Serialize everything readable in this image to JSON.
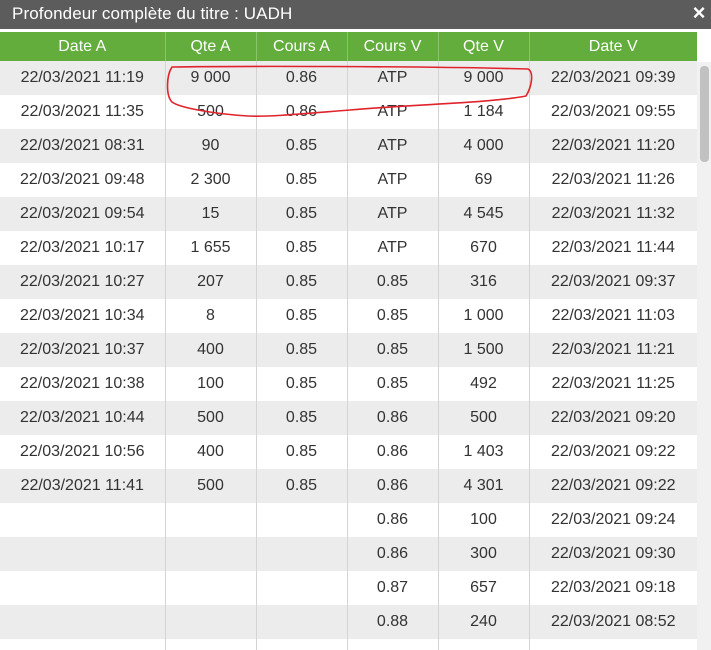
{
  "window": {
    "title": "Profondeur complète du titre : UADH",
    "close_icon": "×"
  },
  "table": {
    "columns": [
      "Date A",
      "Qte A",
      "Cours A",
      "Cours V",
      "Qte V",
      "Date V"
    ],
    "rows": [
      [
        "22/03/2021 11:19",
        "9 000",
        "0.86",
        "ATP",
        "9 000",
        "22/03/2021 09:39"
      ],
      [
        "22/03/2021 11:35",
        "500",
        "0.86",
        "ATP",
        "1 184",
        "22/03/2021 09:55"
      ],
      [
        "22/03/2021 08:31",
        "90",
        "0.85",
        "ATP",
        "4 000",
        "22/03/2021 11:20"
      ],
      [
        "22/03/2021 09:48",
        "2 300",
        "0.85",
        "ATP",
        "69",
        "22/03/2021 11:26"
      ],
      [
        "22/03/2021 09:54",
        "15",
        "0.85",
        "ATP",
        "4 545",
        "22/03/2021 11:32"
      ],
      [
        "22/03/2021 10:17",
        "1 655",
        "0.85",
        "ATP",
        "670",
        "22/03/2021 11:44"
      ],
      [
        "22/03/2021 10:27",
        "207",
        "0.85",
        "0.85",
        "316",
        "22/03/2021 09:37"
      ],
      [
        "22/03/2021 10:34",
        "8",
        "0.85",
        "0.85",
        "1 000",
        "22/03/2021 11:03"
      ],
      [
        "22/03/2021 10:37",
        "400",
        "0.85",
        "0.85",
        "1 500",
        "22/03/2021 11:21"
      ],
      [
        "22/03/2021 10:38",
        "100",
        "0.85",
        "0.85",
        "492",
        "22/03/2021 11:25"
      ],
      [
        "22/03/2021 10:44",
        "500",
        "0.85",
        "0.86",
        "500",
        "22/03/2021 09:20"
      ],
      [
        "22/03/2021 10:56",
        "400",
        "0.85",
        "0.86",
        "1 403",
        "22/03/2021 09:22"
      ],
      [
        "22/03/2021 11:41",
        "500",
        "0.85",
        "0.86",
        "4 301",
        "22/03/2021 09:22"
      ],
      [
        "",
        "",
        "",
        "0.86",
        "100",
        "22/03/2021 09:24"
      ],
      [
        "",
        "",
        "",
        "0.86",
        "300",
        "22/03/2021 09:30"
      ],
      [
        "",
        "",
        "",
        "0.87",
        "657",
        "22/03/2021 09:18"
      ],
      [
        "",
        "",
        "",
        "0.88",
        "240",
        "22/03/2021 08:52"
      ],
      [
        "",
        "",
        "",
        "",
        "",
        ""
      ]
    ]
  },
  "colors": {
    "header_bg": "#62ad3c",
    "titlebar_bg": "#5c5c5c",
    "row_alt_bg": "#ececec",
    "annotation_red": "#e0242c"
  }
}
